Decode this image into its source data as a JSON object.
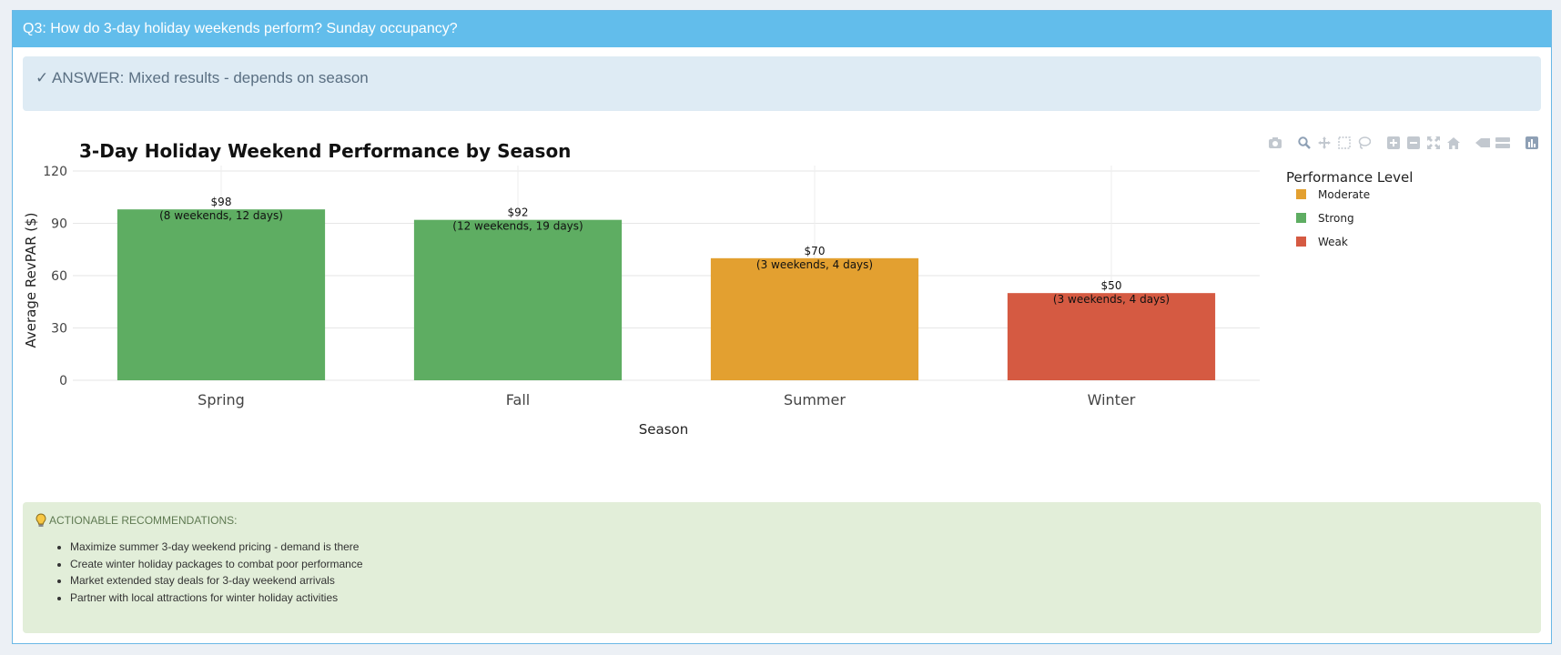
{
  "panel": {
    "header": "Q3: How do 3-day holiday weekends perform? Sunday occupancy?",
    "answer": "✓ ANSWER: Mixed results - depends on season"
  },
  "modebar": {
    "icons": [
      "camera-icon",
      "zoom-icon",
      "pan-icon",
      "box-select-icon",
      "lasso-icon",
      "zoom-in-icon",
      "zoom-out-icon",
      "autoscale-icon",
      "home-icon",
      "spike-lines-icon",
      "hover-compare-icon",
      "plotly-logo-icon"
    ]
  },
  "chart_data": {
    "type": "bar",
    "title": "3-Day Holiday Weekend Performance by Season",
    "xlabel": "Season",
    "ylabel": "Average RevPAR ($)",
    "ylim": [
      0,
      120
    ],
    "yticks": [
      "0",
      "30",
      "60",
      "90",
      "120"
    ],
    "categories": [
      "Spring",
      "Fall",
      "Summer",
      "Winter"
    ],
    "values": [
      98,
      92,
      70,
      50
    ],
    "value_labels": [
      "$98",
      "$92",
      "$70",
      "$50"
    ],
    "sub_labels": [
      "(8 weekends, 12 days)",
      "(12 weekends, 19 days)",
      "(3 weekends, 4 days)",
      "(3 weekends, 4 days)"
    ],
    "performance": [
      "Strong",
      "Strong",
      "Moderate",
      "Weak"
    ],
    "grid": true,
    "legend": {
      "title": "Performance Level",
      "placement": "top-right",
      "entries": [
        {
          "name": "Moderate",
          "color": "#e3a030"
        },
        {
          "name": "Strong",
          "color": "#5ead62"
        },
        {
          "name": "Weak",
          "color": "#d55a42"
        }
      ]
    }
  },
  "recommendations": {
    "heading": "ACTIONABLE RECOMMENDATIONS:",
    "items": [
      "Maximize summer 3-day weekend pricing - demand is there",
      "Create winter holiday packages to combat poor performance",
      "Market extended stay deals for 3-day weekend arrivals",
      "Partner with local attractions for winter holiday activities"
    ]
  }
}
